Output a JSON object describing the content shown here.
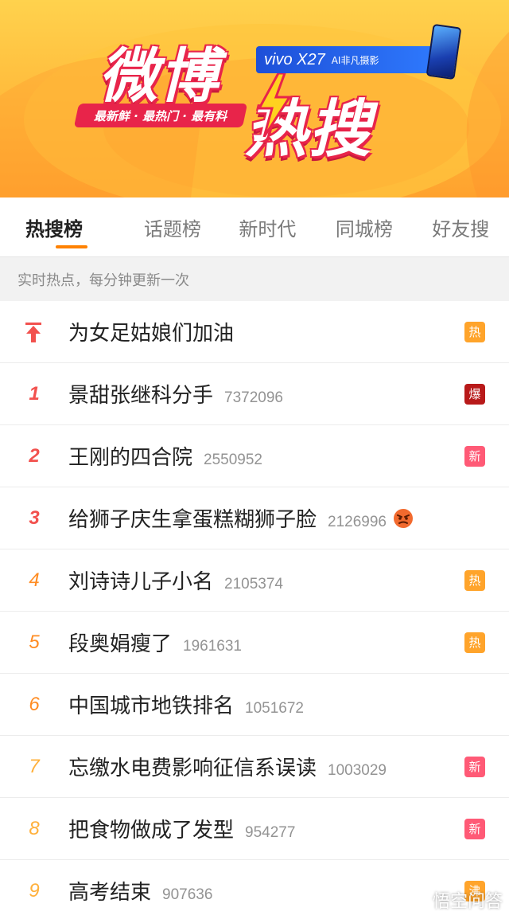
{
  "banner": {
    "brand_title_1": "微博",
    "brand_title_2": "热搜",
    "slogan": "最新鲜 · 最热门 · 最有料",
    "ad_model": "vivo X27",
    "ad_tagline": "AI非凡摄影"
  },
  "tabs": [
    {
      "label": "热搜榜",
      "active": true
    },
    {
      "label": "话题榜",
      "active": false
    },
    {
      "label": "新时代",
      "active": false
    },
    {
      "label": "同城榜",
      "active": false
    },
    {
      "label": "好友搜",
      "active": false
    }
  ],
  "notice": "实时热点，每分钟更新一次",
  "list": [
    {
      "rank": "",
      "title": "为女足姑娘们加油",
      "count": "",
      "badge": "热",
      "badge_type": "hot"
    },
    {
      "rank": "1",
      "title": "景甜张继科分手",
      "count": "7372096",
      "badge": "爆",
      "badge_type": "boom"
    },
    {
      "rank": "2",
      "title": "王刚的四合院",
      "count": "2550952",
      "badge": "新",
      "badge_type": "new"
    },
    {
      "rank": "3",
      "title": "给狮子庆生拿蛋糕糊狮子脸",
      "count": "2126996",
      "badge": "",
      "badge_type": "emoji"
    },
    {
      "rank": "4",
      "title": "刘诗诗儿子小名",
      "count": "2105374",
      "badge": "热",
      "badge_type": "hot"
    },
    {
      "rank": "5",
      "title": "段奥娟瘦了",
      "count": "1961631",
      "badge": "热",
      "badge_type": "hot"
    },
    {
      "rank": "6",
      "title": "中国城市地铁排名",
      "count": "1051672",
      "badge": "",
      "badge_type": "none"
    },
    {
      "rank": "7",
      "title": "忘缴水电费影响征信系误读",
      "count": "1003029",
      "badge": "新",
      "badge_type": "new"
    },
    {
      "rank": "8",
      "title": "把食物做成了发型",
      "count": "954277",
      "badge": "新",
      "badge_type": "new"
    },
    {
      "rank": "9",
      "title": "高考结束",
      "count": "907636",
      "badge": "沸",
      "badge_type": "hot"
    }
  ],
  "watermark": "悟空问答",
  "colors": {
    "accent": "#ff8200",
    "rank_top": "#f2514e",
    "badge_hot": "#ffa42b",
    "badge_boom": "#b81a1a",
    "badge_new": "#ff5a76"
  }
}
